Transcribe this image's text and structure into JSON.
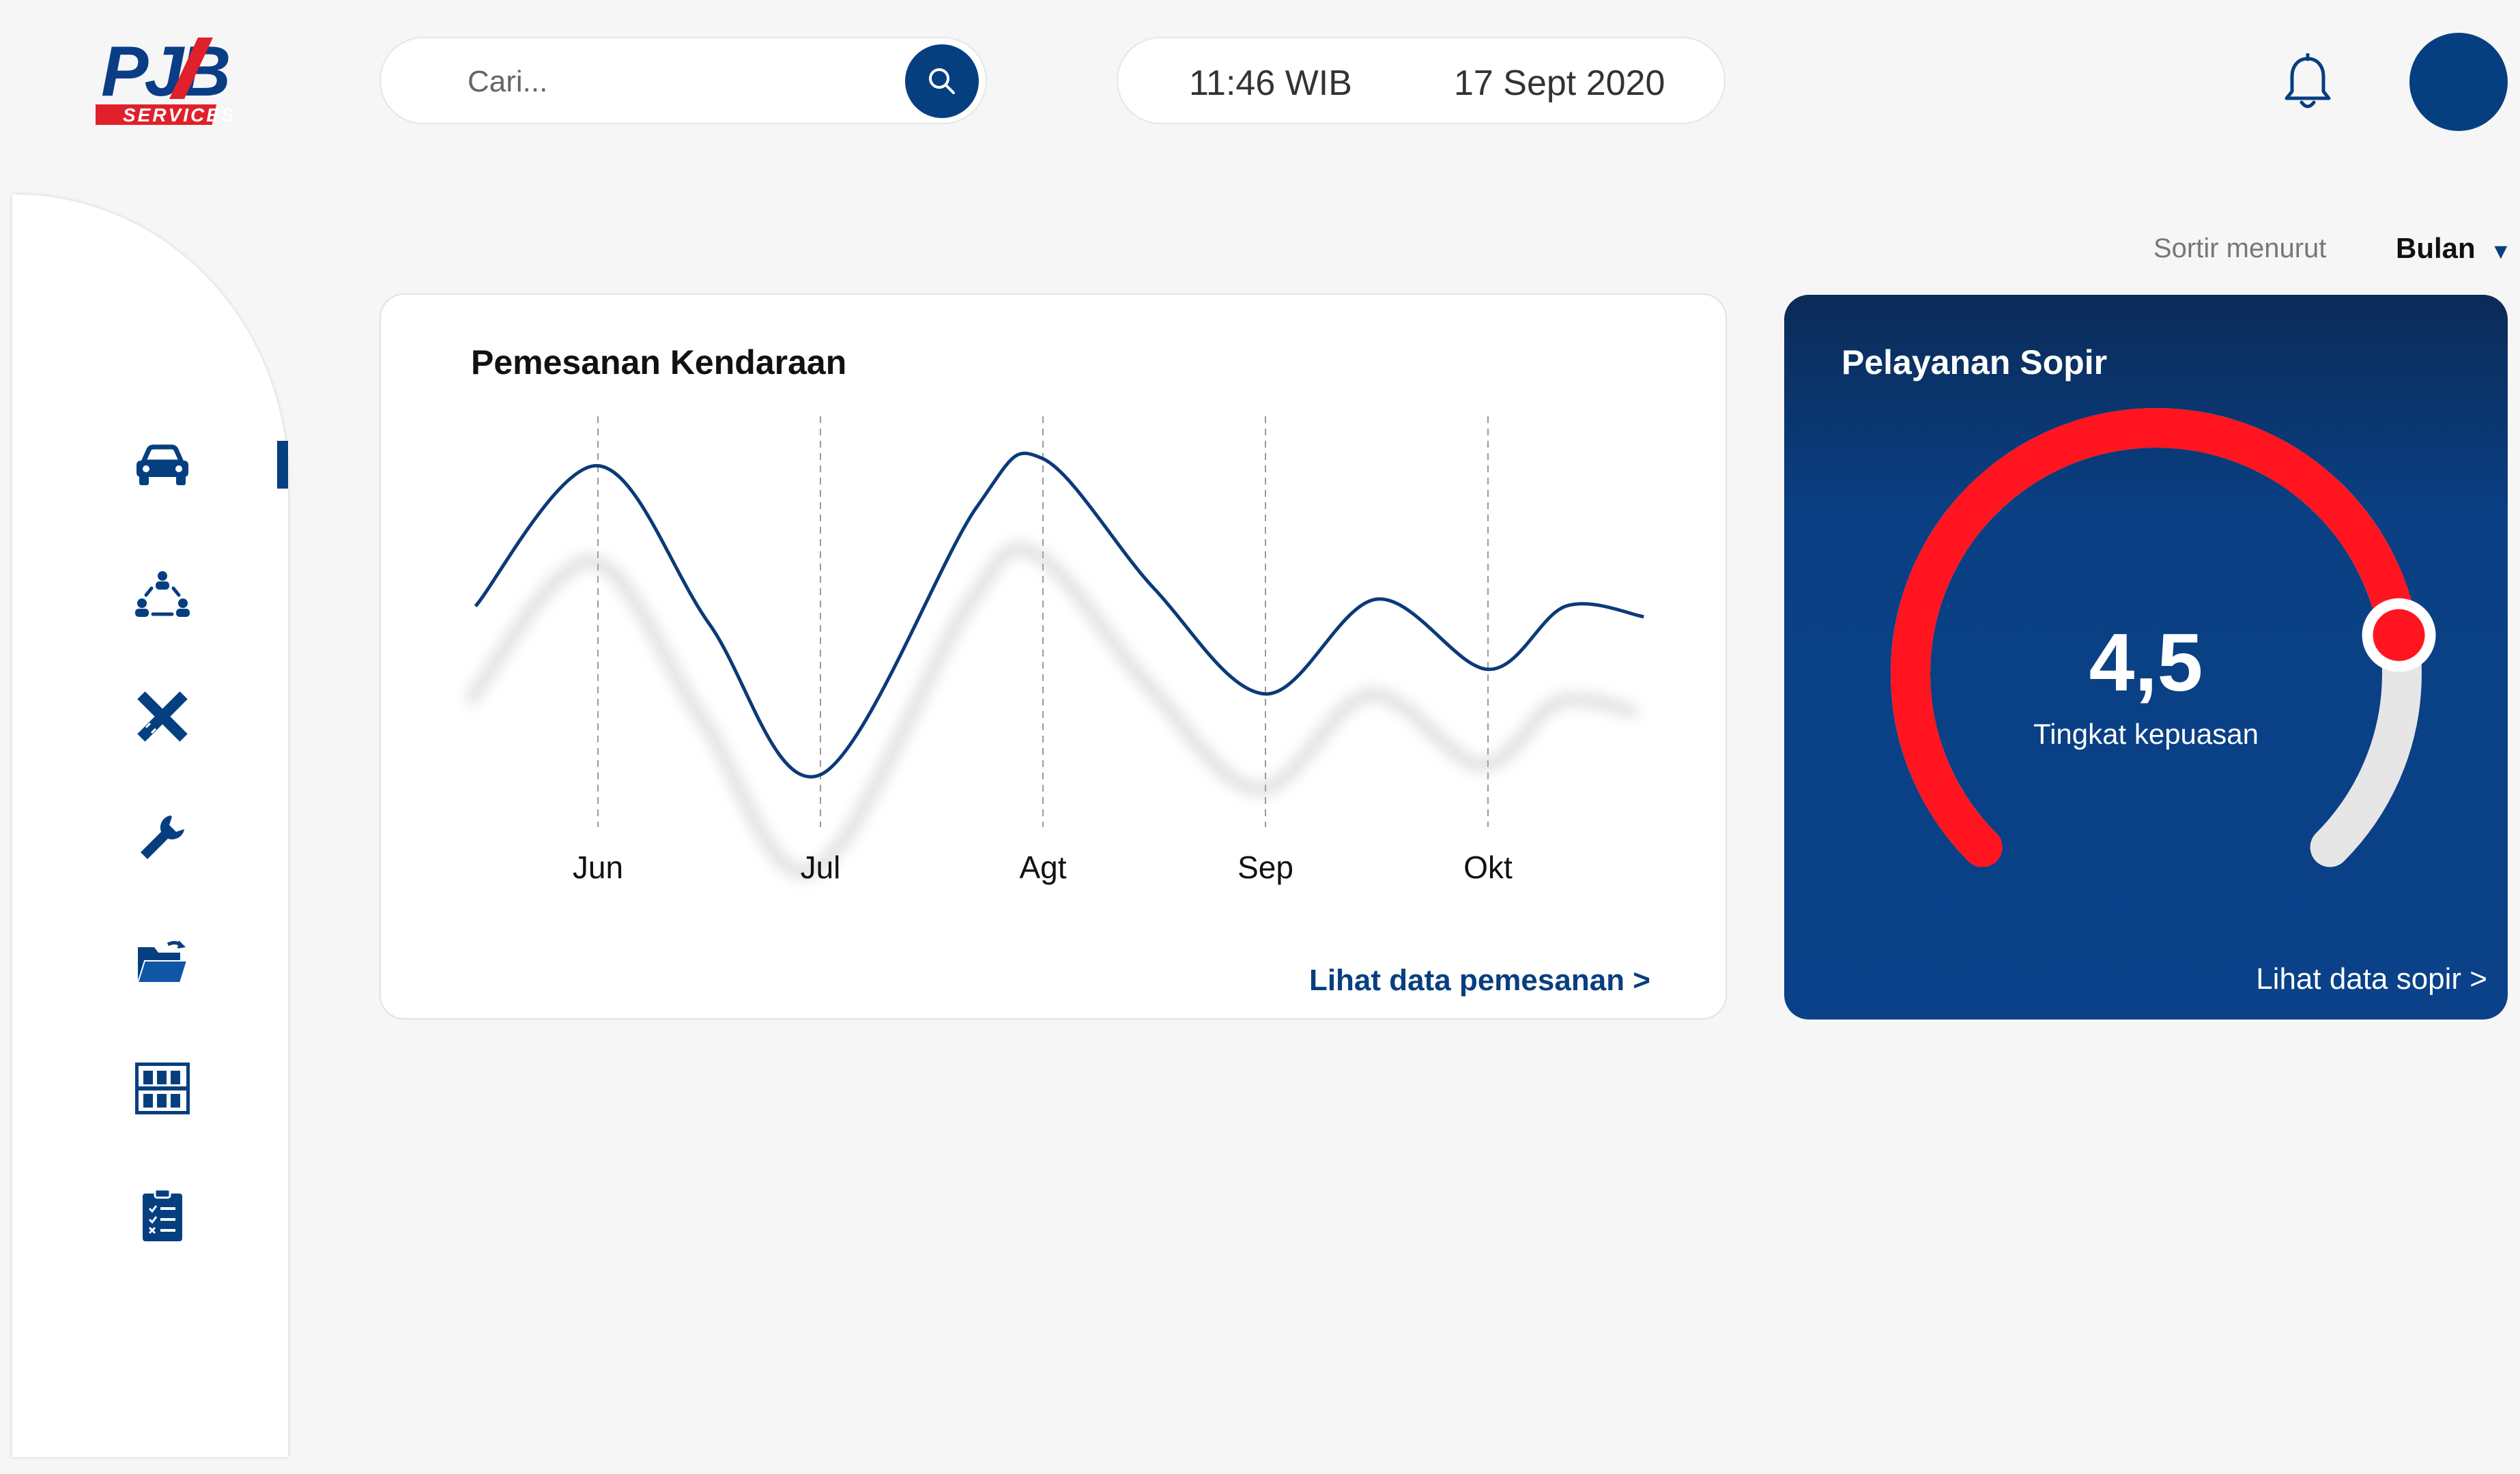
{
  "brand": {
    "logo_top": "PJB",
    "logo_bottom": "SERVICES",
    "colors": {
      "blue": "#063f80",
      "red": "#e0202a"
    }
  },
  "header": {
    "search_placeholder": "Cari...",
    "time": "11:46 WIB",
    "date": "17 Sept 2020",
    "icons": [
      "search-icon",
      "bell-icon"
    ]
  },
  "sidebar": {
    "items": [
      {
        "icon": "car-icon",
        "active": true
      },
      {
        "icon": "people-network-icon",
        "active": false
      },
      {
        "icon": "ruler-pencil-icon",
        "active": false
      },
      {
        "icon": "wrench-icon",
        "active": false
      },
      {
        "icon": "folder-upload-icon",
        "active": false
      },
      {
        "icon": "warehouse-shelf-icon",
        "active": false
      },
      {
        "icon": "clipboard-checklist-icon",
        "active": false
      }
    ]
  },
  "sort": {
    "label": "Sortir menurut",
    "value": "Bulan"
  },
  "chart_card": {
    "title": "Pemesanan Kendaraan",
    "link": "Lihat data pemesanan  >"
  },
  "driver_card": {
    "title": "Pelayanan Sopir",
    "rating": "4,5",
    "rating_label": "Tingkat kepuasan",
    "link": "Lihat data sopir  >",
    "gauge_fraction": 0.8,
    "colors": {
      "fill": "#ff1420",
      "track": "#e6e6e6"
    }
  },
  "chart_data": {
    "type": "line",
    "categories": [
      "Jun",
      "Jul",
      "Agt",
      "Sep",
      "Okt"
    ],
    "grid": "vertical dashed lines at each month",
    "series": [
      {
        "x": [
          -0.55,
          0,
          0.5,
          1,
          1.7,
          2,
          2.5,
          3,
          3.5,
          4,
          4.35,
          4.7
        ],
        "values": [
          0.6,
          1.0,
          0.55,
          0.12,
          0.88,
          1.02,
          0.65,
          0.35,
          0.62,
          0.42,
          0.6,
          0.57
        ],
        "color": "#0b3a78"
      }
    ]
  }
}
